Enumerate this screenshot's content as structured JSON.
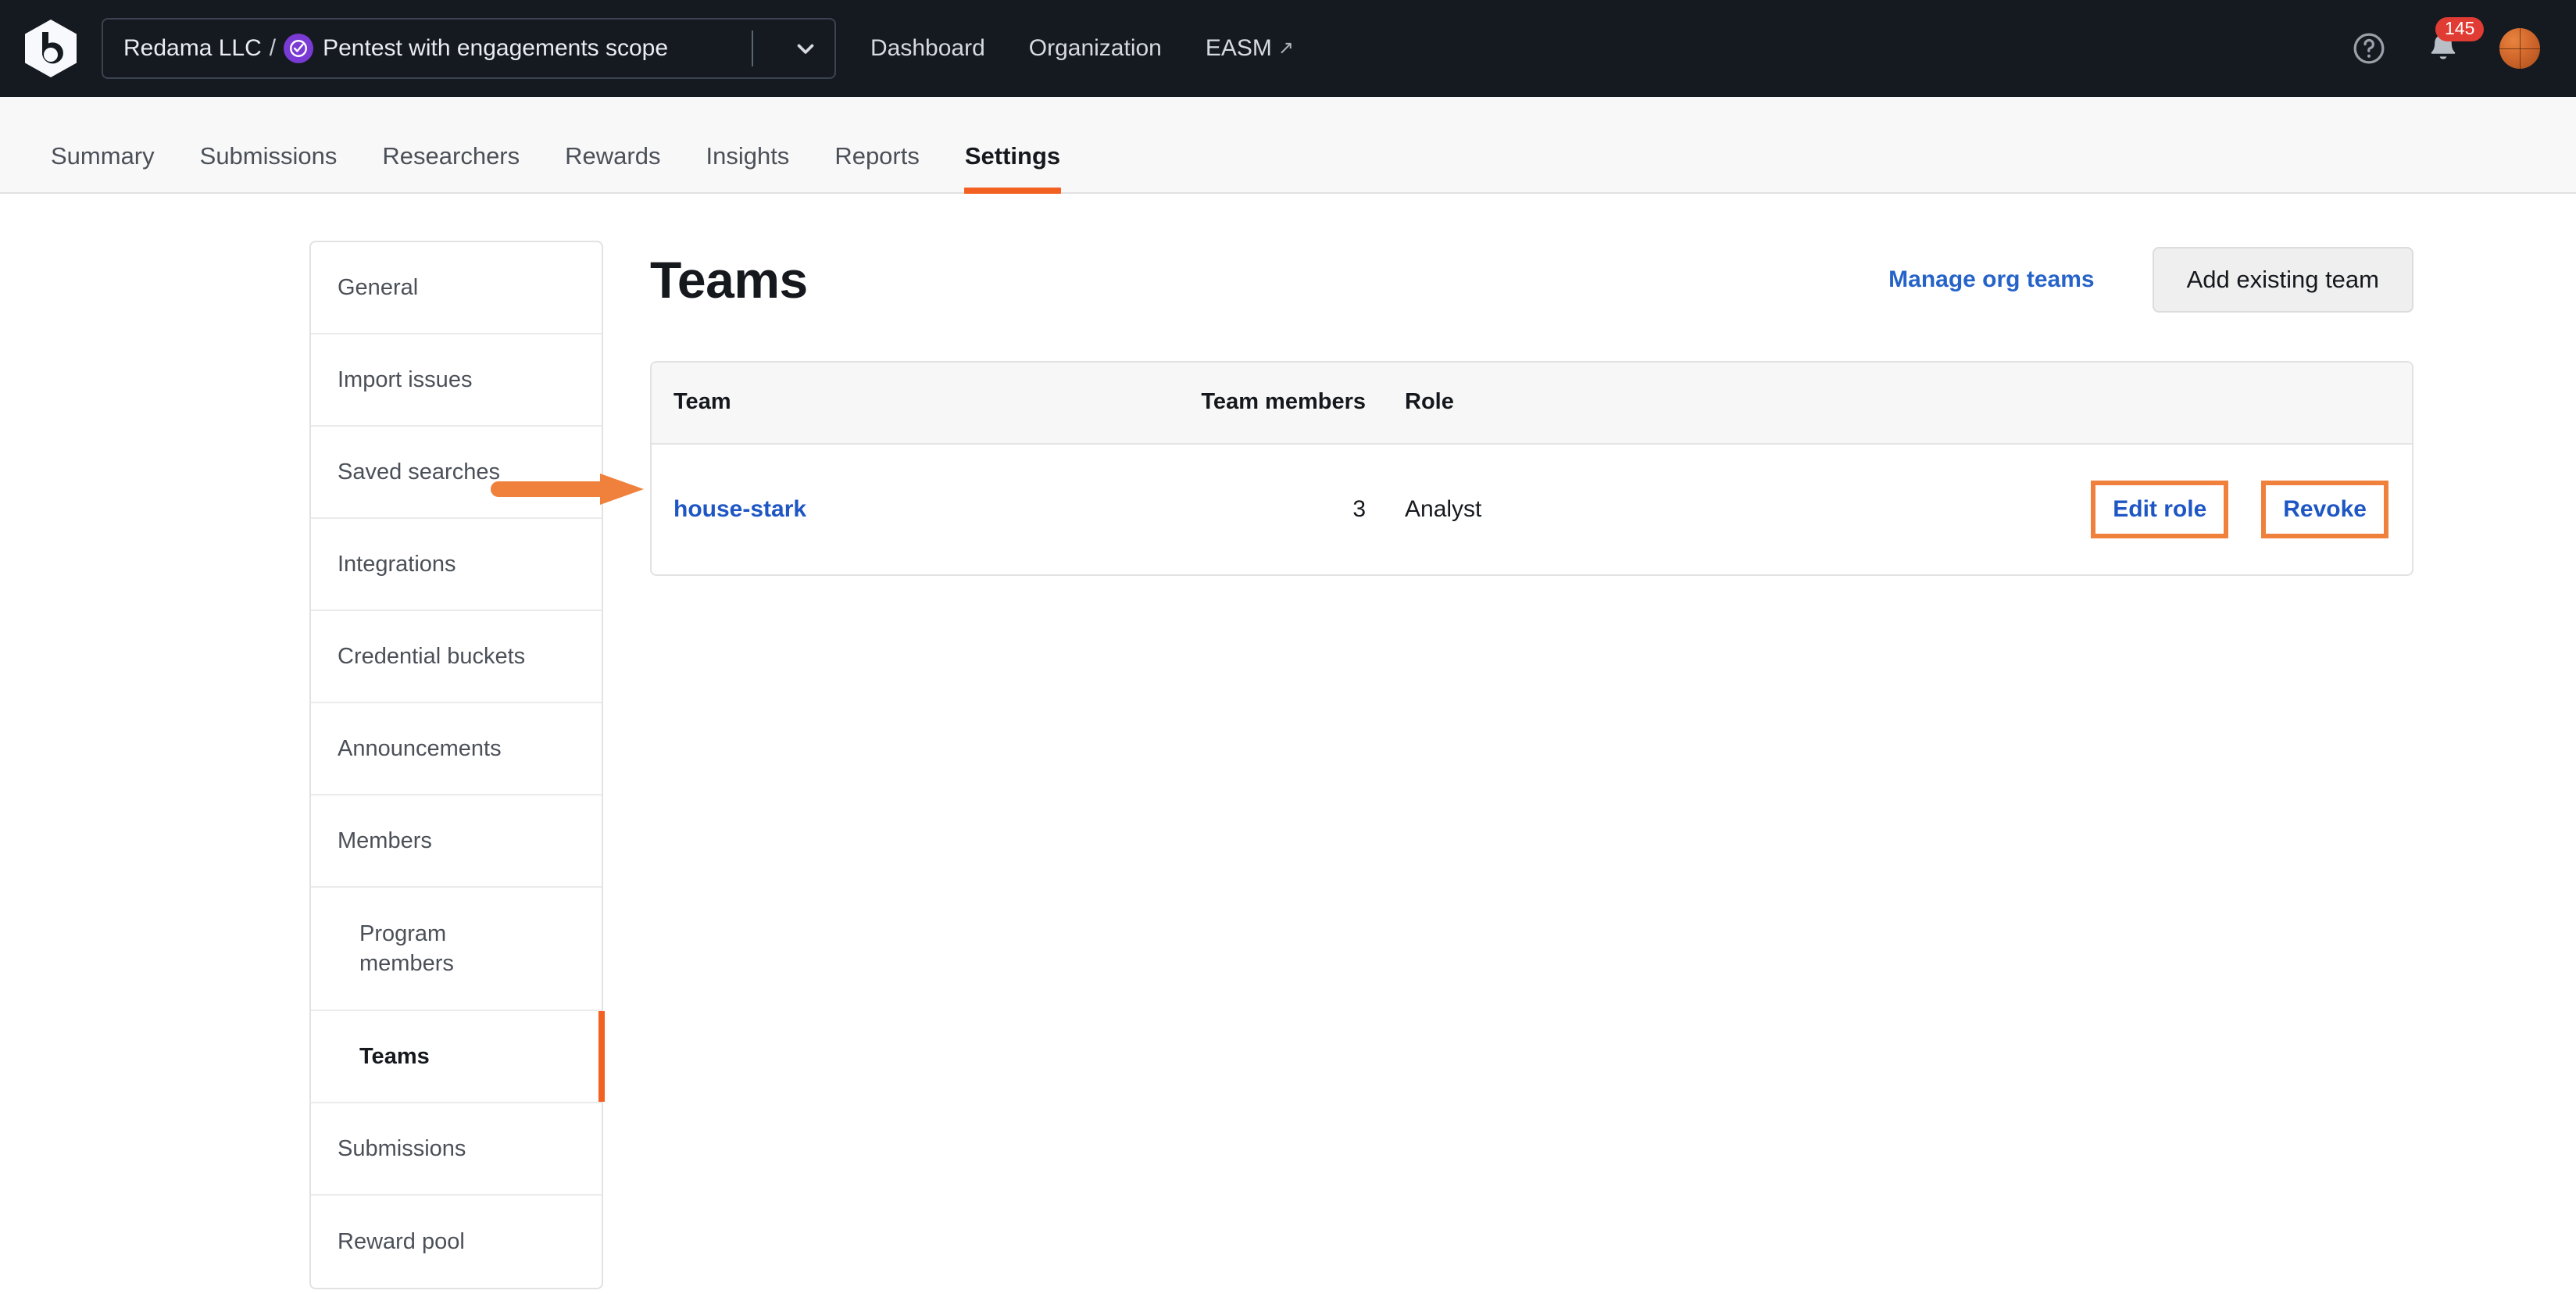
{
  "topbar": {
    "logo": "bugcrowd-logo",
    "program_selector": {
      "org": "Redama LLC",
      "separator": "/",
      "badge_icon": "verified-check-icon",
      "program": "Pentest with engagements scope",
      "chevron_icon": "chevron-down-icon"
    },
    "links": [
      {
        "label": "Dashboard",
        "external": false
      },
      {
        "label": "Organization",
        "external": false
      },
      {
        "label": "EASM",
        "external": true,
        "external_glyph": "↗"
      }
    ],
    "help_icon": "question-circle-icon",
    "notifications": {
      "icon": "bell-icon",
      "count": "145",
      "badge_color": "#E13C33"
    },
    "avatar": "user-avatar"
  },
  "nav_tabs": {
    "items": [
      {
        "label": "Summary",
        "active": false
      },
      {
        "label": "Submissions",
        "active": false
      },
      {
        "label": "Researchers",
        "active": false
      },
      {
        "label": "Rewards",
        "active": false
      },
      {
        "label": "Insights",
        "active": false
      },
      {
        "label": "Reports",
        "active": false
      },
      {
        "label": "Settings",
        "active": true
      }
    ],
    "active_color": "#F26122"
  },
  "settings_nav": {
    "items": [
      {
        "label": "General",
        "sub": false,
        "active": false
      },
      {
        "label": "Import issues",
        "sub": false,
        "active": false
      },
      {
        "label": "Saved searches",
        "sub": false,
        "active": false
      },
      {
        "label": "Integrations",
        "sub": false,
        "active": false
      },
      {
        "label": "Credential buckets",
        "sub": false,
        "active": false
      },
      {
        "label": "Announcements",
        "sub": false,
        "active": false
      },
      {
        "label": "Members",
        "sub": false,
        "active": false
      },
      {
        "label": "Program members",
        "sub": true,
        "active": false
      },
      {
        "label": "Teams",
        "sub": true,
        "active": true
      },
      {
        "label": "Submissions",
        "sub": false,
        "active": false
      },
      {
        "label": "Reward pool",
        "sub": false,
        "active": false
      }
    ],
    "active_indicator_color": "#F26122"
  },
  "main": {
    "title": "Teams",
    "manage_org_teams_label": "Manage org teams",
    "add_existing_team_label": "Add existing team",
    "table": {
      "columns": [
        "Team",
        "Team members",
        "Role",
        ""
      ],
      "rows": [
        {
          "team": "house-stark",
          "members": "3",
          "role": "Analyst",
          "edit_label": "Edit role",
          "revoke_label": "Revoke"
        }
      ]
    }
  },
  "annotations": {
    "arrow_color": "#F0813C",
    "highlight_color": "#F0813C",
    "arrow_target": "house-stark",
    "highlighted_elements": [
      "Edit role",
      "Revoke"
    ]
  }
}
